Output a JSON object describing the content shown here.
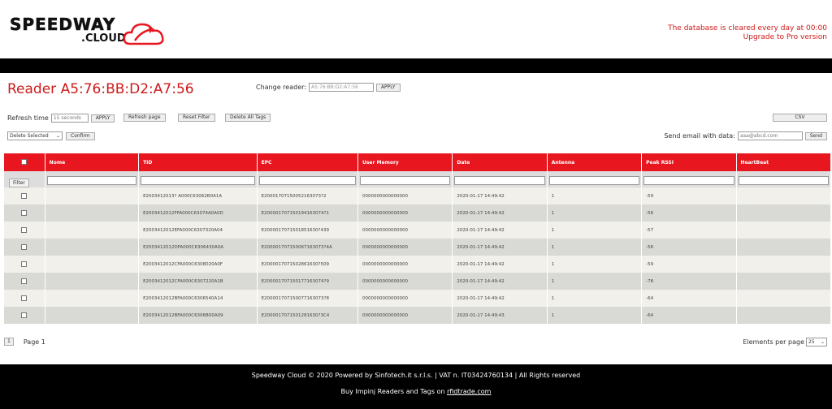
{
  "header": {
    "logo_word1": "SPEEDWAY",
    "logo_word2": ".CLOUD",
    "notice": "The database is cleared every day at 00:00",
    "upgrade": "Upgrade to Pro version"
  },
  "reader": {
    "title": "Reader A5:76:BB:D2:A7:56",
    "change_label": "Change reader:",
    "change_value": "A5:76:BB:D2:A7:56",
    "apply_label": "APPLY"
  },
  "controls": {
    "refresh_label": "Refresh time",
    "refresh_value": "15 seconds",
    "refresh_apply": "APPLY",
    "refresh_page": "Refresh page",
    "reset_filter": "Reset Filter",
    "delete_all": "Delete All Tags",
    "csv": "CSV",
    "delete_selected": "Delete Selected",
    "confirm": "Confirm",
    "send_label": "Send email with data:",
    "send_placeholder": "aaa@abcd.com",
    "send_button": "Send"
  },
  "table": {
    "columns": [
      "Nome",
      "TID",
      "EPC",
      "User Memory",
      "Date",
      "Antenna",
      "Peak RSSI",
      "HeartBeat"
    ],
    "filter_label": "Filter",
    "rows": [
      {
        "nome": "",
        "tid": "E2003412013? A000C63062B0A1A",
        "epc": "E20001707150052163073?2",
        "mem": "0000000000000000",
        "date": "2020-01-17 14:49:42",
        "antenna": "1",
        "rssi": "-59",
        "hb": ""
      },
      {
        "nome": "",
        "tid": "E2003412012FFA000C63074A0A0D",
        "epc": "E200001707150194163074?1",
        "mem": "0000000000000000",
        "date": "2020-01-17 14:49:42",
        "antenna": "1",
        "rssi": "-56",
        "hb": ""
      },
      {
        "nome": "",
        "tid": "E2003412012EFA000C6307320A04",
        "epc": "E2000017071501851630?439",
        "mem": "0000000000000000",
        "date": "2020-01-17 14:49:42",
        "antenna": "1",
        "rssi": "-57",
        "hb": ""
      },
      {
        "nome": "",
        "tid": "E2003412012DFA000C6306430A0A",
        "epc": "E200001707150067163073?4A",
        "mem": "0000000000000000",
        "date": "2020-01-17 14:49:42",
        "antenna": "1",
        "rssi": "-56",
        "hb": ""
      },
      {
        "nome": "",
        "tid": "E2003412012CFA000C6308020A0F",
        "epc": "E2000017071502861630?509",
        "mem": "0000000000000000",
        "date": "2020-01-17 14:49:42",
        "antenna": "1",
        "rssi": "-59",
        "hb": ""
      },
      {
        "nome": "",
        "tid": "E2003412012CFA000C6307220A1B",
        "epc": "E200001707150177163074?9",
        "mem": "0000000000000000",
        "date": "2020-01-17 14:49:42",
        "antenna": "1",
        "rssi": "-78",
        "hb": ""
      },
      {
        "nome": "",
        "tid": "E2003412012BFA000C6306540A14",
        "epc": "E200001707150077163073?8",
        "mem": "0000000000000000",
        "date": "2020-01-17 14:49:42",
        "antenna": "1",
        "rssi": "-64",
        "hb": ""
      },
      {
        "nome": "",
        "tid": "E2003412012BFA000C6306B00A09",
        "epc": "E2000017071501281630?3C4",
        "mem": "0000000000000000",
        "date": "2020-01-17 14:49:43",
        "antenna": "1",
        "rssi": "-64",
        "hb": ""
      }
    ]
  },
  "pagination": {
    "page_number": "1",
    "page_label": "Page 1",
    "elements_label": "Elements per page",
    "elements_value": "25"
  },
  "footer": {
    "line1": "Speedway Cloud © 2020 Powered by Sinfotech.it s.r.l.s. | VAT n. IT03424760134 | All Rights reserved",
    "line2_prefix": "Buy Impinj Readers and Tags on ",
    "line2_link": "rfidtrade.com"
  },
  "colors": {
    "accent": "#e8171f",
    "title_red": "#cc1a1a"
  }
}
